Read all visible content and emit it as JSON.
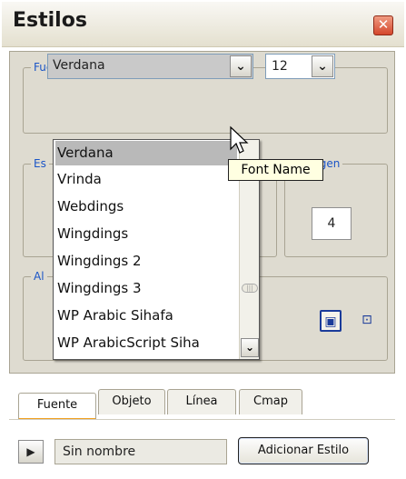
{
  "window": {
    "title": "Estilos",
    "close_icon": "close-icon"
  },
  "groups": {
    "font_size": "Fuente & Tamaño",
    "es_group": "Es",
    "margin_group": "rgen",
    "al_group": "Al"
  },
  "font_combo": {
    "value": "Verdana"
  },
  "size_combo": {
    "value": "12"
  },
  "margin_value": "4",
  "dropdown": {
    "items": [
      "Verdana",
      "Vrinda",
      "Webdings",
      "Wingdings",
      "Wingdings 2",
      "Wingdings 3",
      "WP Arabic Sihafa",
      "WP ArabicScript Siha"
    ],
    "selected": "Verdana"
  },
  "tooltip": "Font Name",
  "tabs": [
    "Fuente",
    "Objeto",
    "Línea",
    "Cmap"
  ],
  "active_tab": "Fuente",
  "footer": {
    "name_field": "Sin nombre",
    "add_button": "Adicionar Estilo"
  }
}
